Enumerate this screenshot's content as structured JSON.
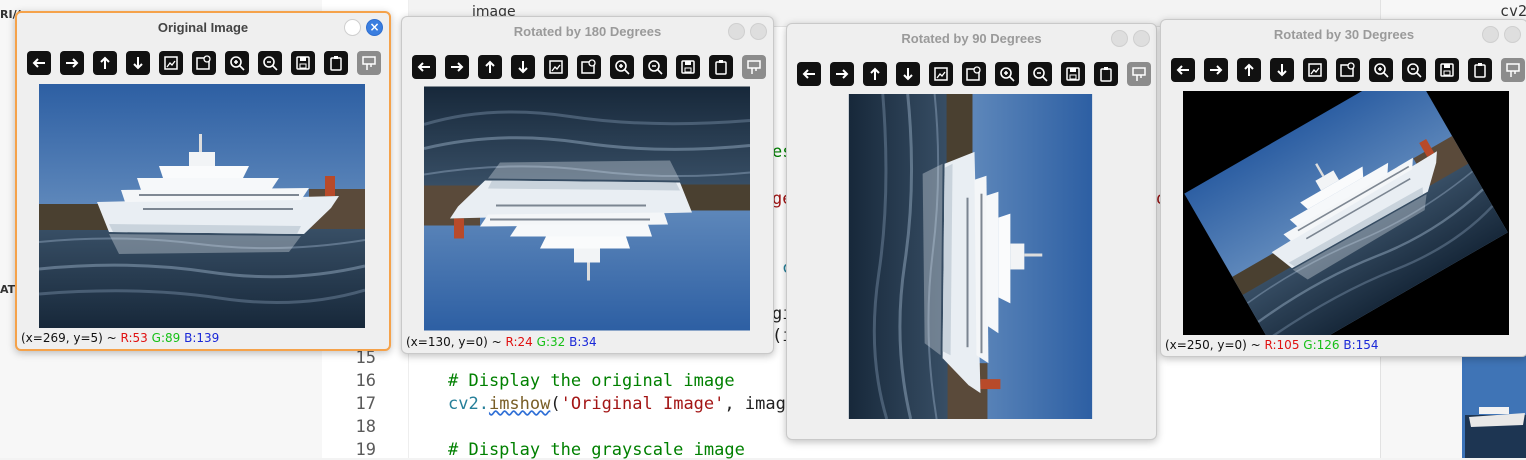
{
  "editor": {
    "left_fragments": [
      "RI/(",
      "ATC"
    ],
    "tab_label": "image",
    "right_label": "cv2",
    "lines": [
      {
        "num": "15",
        "text": ""
      },
      {
        "num": "16",
        "text": "# Display the original image"
      },
      {
        "num": "17",
        "fn_mod": "cv2.",
        "fn": "imshow",
        "args_open": "(",
        "arg_str": "'Original Image'",
        "args_rest": ", image"
      },
      {
        "num": "18",
        "text": ""
      },
      {
        "num": "19",
        "text": "# Display the grayscale image"
      }
    ],
    "fragments": {
      "f1": "es",
      "f2": "ge",
      "f3": "c",
      "f4": "gi",
      "f5": "(i",
      "f6": "o"
    }
  },
  "windows": [
    {
      "title": "Original Image",
      "status": {
        "coords": "(x=269, y=5) ~ ",
        "r": "R:53",
        "g": "G:89",
        "b": "B:139"
      }
    },
    {
      "title": "Rotated by 180 Degrees",
      "status": {
        "coords": "(x=130, y=0) ~ ",
        "r": "R:24",
        "g": "G:32",
        "b": "B:34"
      }
    },
    {
      "title": "Rotated by 90 Degrees",
      "status": null
    },
    {
      "title": "Rotated by 30 Degrees",
      "status": {
        "coords": "(x=250, y=0) ~ ",
        "r": "R:105",
        "g": "G:126",
        "b": "B:154"
      }
    }
  ],
  "toolbar_icons": [
    "pan-left-icon",
    "pan-right-icon",
    "pan-up-icon",
    "pan-down-icon",
    "zoom-fit-icon",
    "zoom-to-image-icon",
    "zoom-in-icon",
    "zoom-out-icon",
    "save-icon",
    "copy-clipboard-icon",
    "properties-icon"
  ],
  "colors": {
    "active_border": "#f5a24a",
    "close_button": "#3a7ee0",
    "status_r": "#e01010",
    "status_g": "#16c016",
    "status_b": "#1a28d8"
  }
}
